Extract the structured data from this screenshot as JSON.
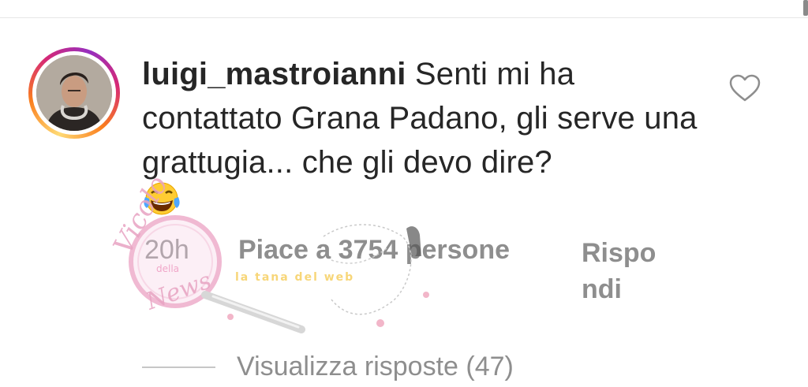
{
  "comment": {
    "username": "luigi_mastroianni",
    "text": "Senti mi ha contattato Grana Padano, gli serve una grattugia... che gli devo dire?",
    "emoji": "face-with-tears-of-joy"
  },
  "meta": {
    "time": "20h",
    "likes": "Piace a 3754 persone",
    "reply_line1": "Rispo",
    "reply_line2": "ndi"
  },
  "replies": {
    "view_label": "Visualizza risposte (47)"
  },
  "watermark": {
    "vicolo": "Vicolo",
    "della": "della",
    "news": "News",
    "tana": "la tana del web"
  },
  "colors": {
    "text_primary": "#262626",
    "text_secondary": "#8e8e8e",
    "story_ring": [
      "#feda75",
      "#fa7e1e",
      "#d62976",
      "#962fbf"
    ]
  }
}
